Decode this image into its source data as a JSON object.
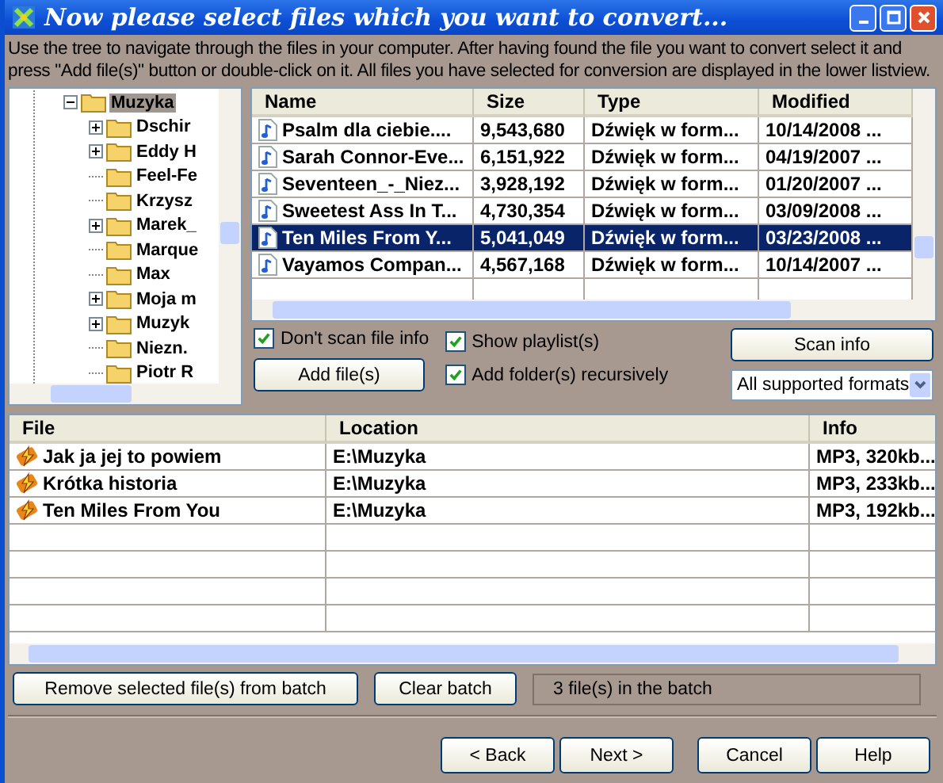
{
  "window": {
    "title": "Now please select files which you want to convert..."
  },
  "instructions": "Use the tree to navigate through the files in your computer. After having found the file you want to convert select it and press \"Add file(s)\" button or double-click on it. All files you have selected for conversion are displayed in the lower listview.",
  "tree": {
    "label": "Muzyka",
    "expanded": true,
    "selected": true,
    "children": [
      {
        "label": "Dschir",
        "kind": "expandable"
      },
      {
        "label": "Eddy H",
        "kind": "expandable"
      },
      {
        "label": "Feel-Fe",
        "kind": "leaf"
      },
      {
        "label": "Krzysz",
        "kind": "leaf"
      },
      {
        "label": "Marek_",
        "kind": "expandable"
      },
      {
        "label": "Marque",
        "kind": "leaf"
      },
      {
        "label": "Max",
        "kind": "leaf"
      },
      {
        "label": "Moja m",
        "kind": "expandable"
      },
      {
        "label": "Muzyk",
        "kind": "expandable"
      },
      {
        "label": "Niezn.",
        "kind": "leaf"
      },
      {
        "label": "Piotr R",
        "kind": "leaf"
      }
    ]
  },
  "file_list": {
    "columns": [
      "Name",
      "Size",
      "Type",
      "Modified"
    ],
    "rows": [
      {
        "name": "Psalm dla ciebie....",
        "size": "9,543,680",
        "type": "Dźwięk w form...",
        "modified": "10/14/2008 ...",
        "selected": false
      },
      {
        "name": "Sarah Connor-Eve...",
        "size": "6,151,922",
        "type": "Dźwięk w form...",
        "modified": "04/19/2007 ...",
        "selected": false
      },
      {
        "name": "Seventeen_-_Niez...",
        "size": "3,928,192",
        "type": "Dźwięk w form...",
        "modified": "01/20/2007 ...",
        "selected": false
      },
      {
        "name": "Sweetest Ass In T...",
        "size": "4,730,354",
        "type": "Dźwięk w form...",
        "modified": "03/09/2008 ...",
        "selected": false
      },
      {
        "name": "Ten Miles From Y...",
        "size": "5,041,049",
        "type": "Dźwięk w form...",
        "modified": "03/23/2008 ...",
        "selected": true
      },
      {
        "name": "Vayamos Compan...",
        "size": "4,567,168",
        "type": "Dźwięk w form...",
        "modified": "10/14/2007 ...",
        "selected": false
      }
    ]
  },
  "options": [
    {
      "label": "Don't scan file info",
      "checked": true
    },
    {
      "label": "Show playlist(s)",
      "checked": true
    },
    {
      "label": "Add folder(s) recursively",
      "checked": true
    }
  ],
  "scan_button": "Scan info",
  "add_button": "Add file(s)",
  "format_filter": "All supported formats",
  "batch": {
    "columns": [
      "File",
      "Location",
      "Info"
    ],
    "rows": [
      {
        "file": "Jak ja jej to powiem",
        "location": "E:\\Muzyka",
        "info": "MP3,  320kb..."
      },
      {
        "file": "Krótka historia",
        "location": "E:\\Muzyka",
        "info": "MP3,  233kb..."
      },
      {
        "file": "Ten Miles From You",
        "location": "E:\\Muzyka",
        "info": "MP3,  192kb..."
      }
    ]
  },
  "remove_button": "Remove selected file(s) from batch",
  "clear_button": "Clear batch",
  "batch_status": "3 file(s) in the batch",
  "nav_buttons": [
    "< Back",
    "Next >",
    "Cancel",
    "Help"
  ]
}
